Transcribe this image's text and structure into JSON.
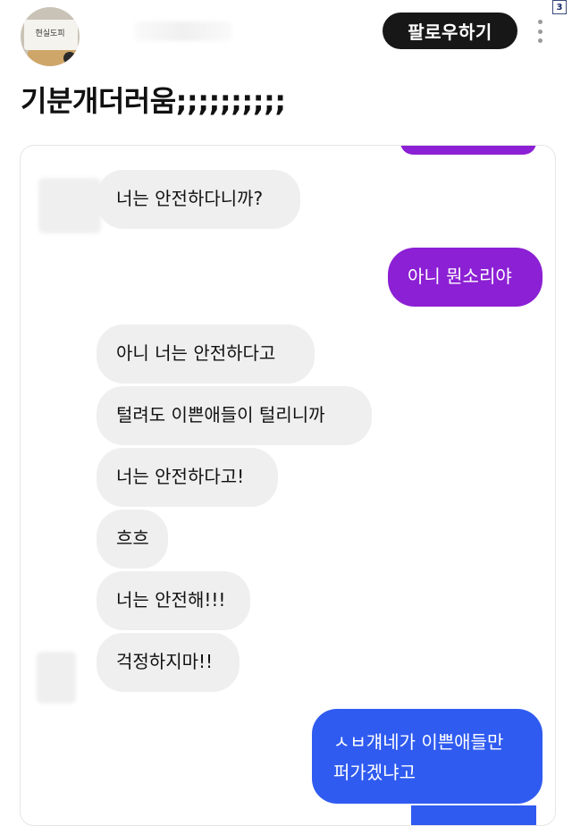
{
  "page_badge": "3",
  "header": {
    "avatar_text": "현실도피",
    "follow_label": "팔로우하기"
  },
  "post": {
    "title": "기분개더러움;;;;;;;;;;"
  },
  "chat": {
    "messages": [
      {
        "side": "in",
        "text": "너는 안전하다니까?"
      },
      {
        "side": "out",
        "text": "아니 뭔소리야"
      },
      {
        "side": "in",
        "text": "아니 너는 안전하다고"
      },
      {
        "side": "in",
        "text": "털려도 이쁜애들이 털리니까"
      },
      {
        "side": "in",
        "text": "너는 안전하다고!"
      },
      {
        "side": "in",
        "text": "흐흐"
      },
      {
        "side": "in",
        "text": "너는 안전해!!!"
      },
      {
        "side": "in",
        "text": "걱정하지마!!"
      },
      {
        "side": "out",
        "text": "ㅅㅂ걔네가 이쁜애들만 퍼가겠냐고"
      }
    ]
  },
  "colors": {
    "purple_bubble": "#8c20d4",
    "blue_bubble": "#2f5bf0",
    "incoming_bubble": "#efefef",
    "follow_button": "#171717"
  }
}
